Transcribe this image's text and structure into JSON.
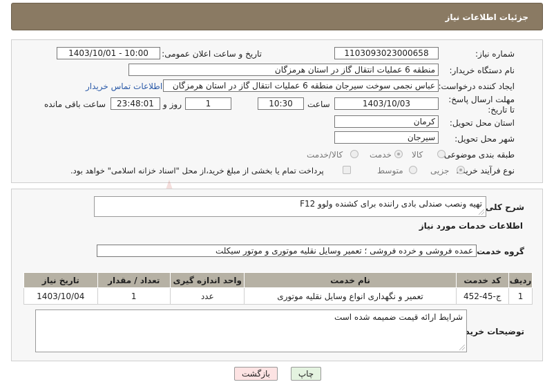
{
  "header": {
    "title": "جزئیات اطلاعات نیاز"
  },
  "form": {
    "need_number_label": "شماره نیاز:",
    "need_number": "1103093023000658",
    "announce_label": "تاریخ و ساعت اعلان عمومی:",
    "announce_value": "1403/10/01 - 10:00",
    "buyer_org_label": "نام دستگاه خریدار:",
    "buyer_org": "منطقه 6 عملیات انتقال گاز در استان هرمزگان",
    "requester_label": "ایجاد کننده درخواست:",
    "requester": "عباس نجمی سوخت سیرجان منطقه 6 عملیات انتقال گاز در استان هرمزگان",
    "contact_link": "اطلاعات تماس خریدار",
    "deadline_label": "مهلت ارسال پاسخ: تا تاریخ:",
    "deadline_date": "1403/10/03",
    "time_label": "ساعت",
    "deadline_time": "10:30",
    "days_value": "1",
    "days_label": "روز و",
    "remaining_time": "23:48:01",
    "remaining_label": "ساعت باقی مانده",
    "province_label": "استان محل تحویل:",
    "province": "کرمان",
    "city_label": "شهر محل تحویل:",
    "city": "سیرجان",
    "category_label": "طبقه بندی موضوعی:",
    "category_options": [
      "کالا",
      "خدمت",
      "کالا/خدمت"
    ],
    "process_label": "نوع فرآیند خرید :",
    "process_options": [
      "جزیی",
      "متوسط"
    ],
    "payment_note": "پرداخت تمام یا بخشی از مبلغ خرید،از محل \"اسناد خزانه اسلامی\" خواهد بود."
  },
  "details": {
    "summary_label": "شرح کلی نیاز:",
    "summary": "تهیه ونصب صندلی بادی راننده برای کشنده ولوو F12",
    "services_heading": "اطلاعات خدمات مورد نیاز",
    "service_group_label": "گروه خدمت:",
    "service_group": "عمده فروشی و خرده فروشی ؛ تعمیر وسایل نقلیه موتوری و موتور سیکلت",
    "table": {
      "headers": [
        "ردیف",
        "کد خدمت",
        "نام خدمت",
        "واحد اندازه گیری",
        "تعداد / مقدار",
        "تاریخ نیاز"
      ],
      "rows": [
        [
          "1",
          "ج-45-452",
          "تعمیر و نگهداری انواع وسایل نقلیه موتوری",
          "عدد",
          "1",
          "1403/10/04"
        ]
      ]
    },
    "buyer_notes_label": "توضیحات خریدار:",
    "buyer_notes": "شرایط ارائه قیمت ضمیمه شده است"
  },
  "buttons": {
    "print": "چاپ",
    "back": "بازگشت"
  },
  "watermark": {
    "text": "AriaTender.neT"
  },
  "colors": {
    "header": "#8a7a63",
    "table_header": "#b6b1a4",
    "link": "#2b5aa8",
    "back_button": "#fde3e3",
    "print_button": "#e4f3e0"
  }
}
